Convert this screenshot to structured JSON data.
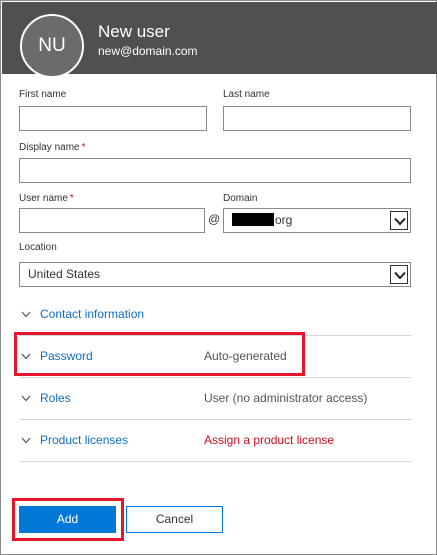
{
  "header": {
    "avatar_initials": "NU",
    "title": "New user",
    "email": "new@domain.com"
  },
  "form": {
    "first_name": {
      "label": "First name",
      "value": ""
    },
    "last_name": {
      "label": "Last name",
      "value": ""
    },
    "display_name": {
      "label": "Display name",
      "required_mark": "*",
      "value": ""
    },
    "user_name": {
      "label": "User name",
      "required_mark": "*",
      "value": ""
    },
    "at_symbol": "@",
    "domain": {
      "label": "Domain",
      "value_suffix": "org"
    },
    "location": {
      "label": "Location",
      "value": "United States"
    }
  },
  "sections": [
    {
      "label": "Contact information",
      "value": ""
    },
    {
      "label": "Password",
      "value": "Auto-generated"
    },
    {
      "label": "Roles",
      "value": "User (no administrator access)"
    },
    {
      "label": "Product licenses",
      "value": "Assign a product license"
    }
  ],
  "buttons": {
    "add": "Add",
    "cancel": "Cancel"
  },
  "colors": {
    "header_bg": "#505050",
    "link": "#106ebe",
    "primary_button": "#0078d7",
    "warning_text": "#c50f1f",
    "highlight_box": "#e3162d"
  }
}
